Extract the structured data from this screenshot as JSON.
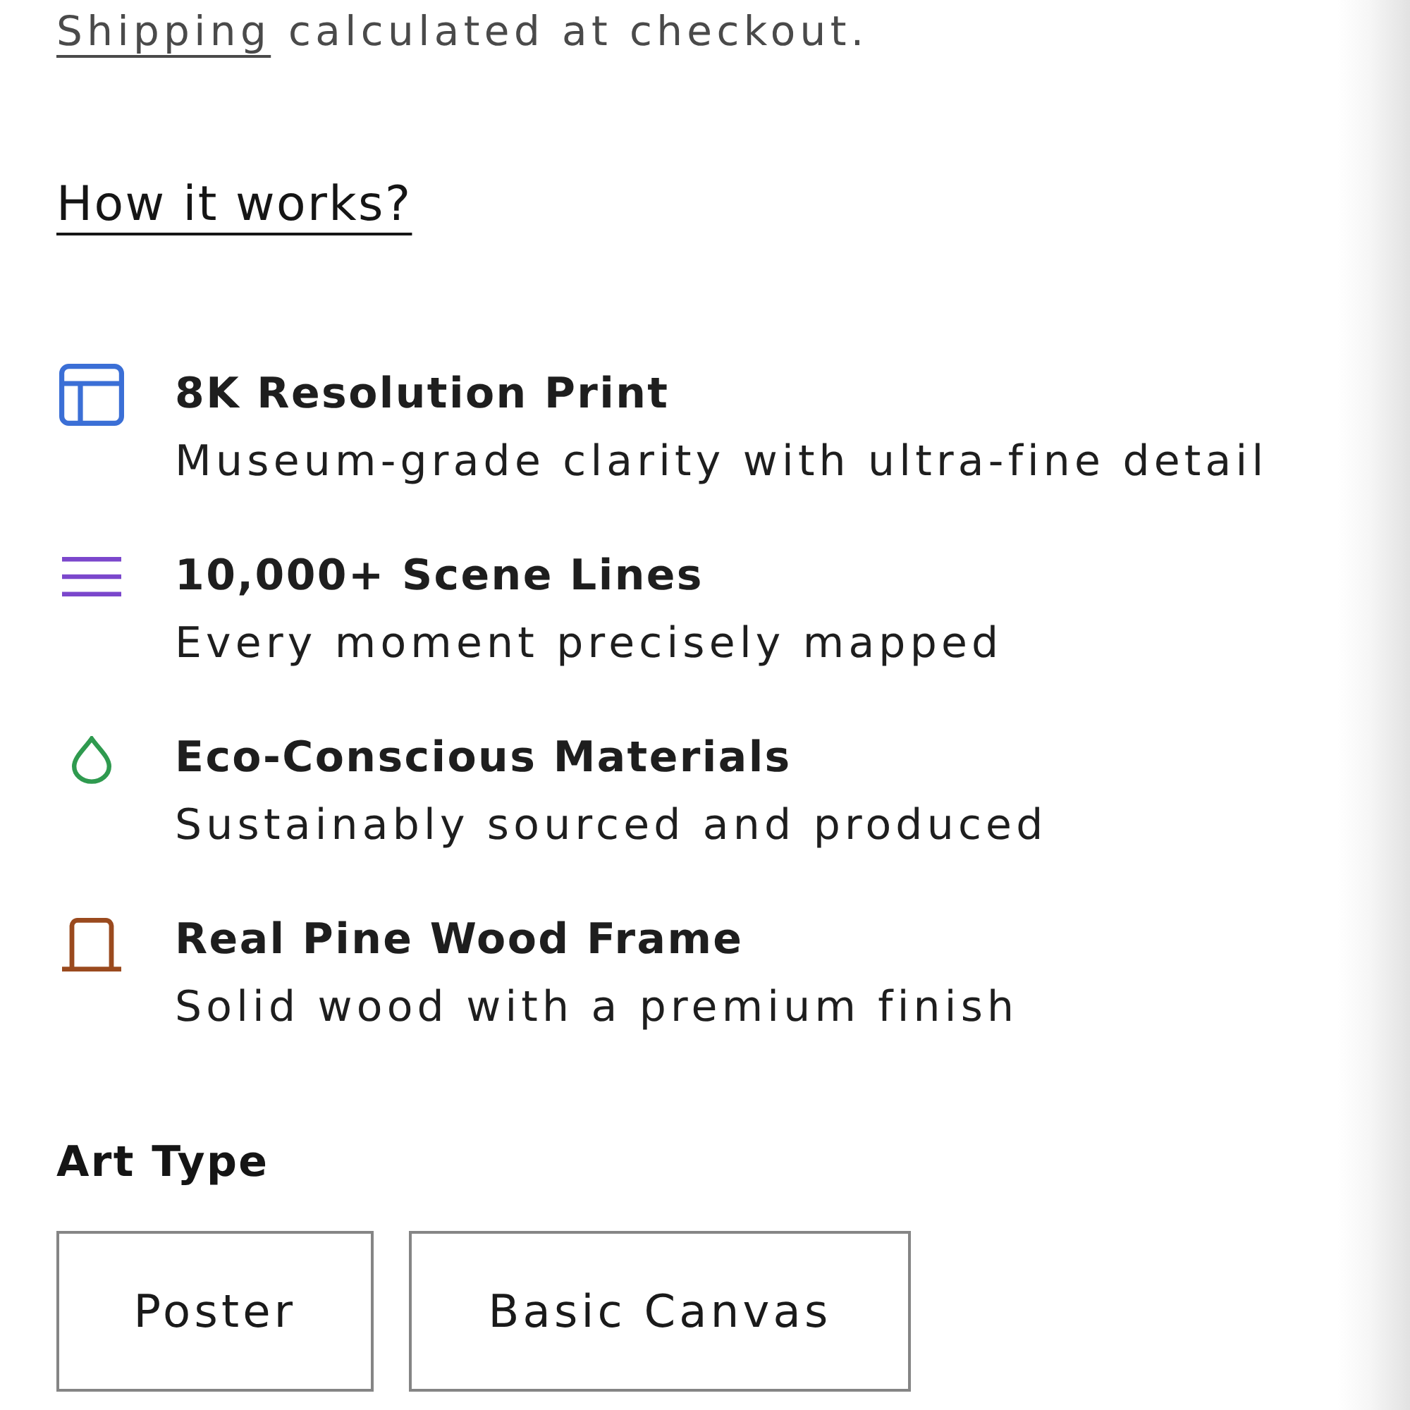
{
  "shipping_note": {
    "link": "Shipping",
    "text": "calculated at checkout."
  },
  "how_it_works_link": "How it works?",
  "features": [
    {
      "title": "8K Resolution Print",
      "description": "Museum-grade clarity with ultra-fine detail",
      "color": "#3b6fd6"
    },
    {
      "title": "10,000+ Scene Lines",
      "description": "Every moment precisely mapped",
      "color": "#7b47cc"
    },
    {
      "title": "Eco-Conscious Materials",
      "description": "Sustainably sourced and produced",
      "color": "#2f9a4f"
    },
    {
      "title": "Real Pine Wood Frame",
      "description": "Solid wood with a premium finish",
      "color": "#9a4a1e"
    }
  ],
  "art_type": {
    "label": "Art Type",
    "options": [
      {
        "label": "Poster",
        "selected": false
      },
      {
        "label": "Basic Canvas",
        "selected": false
      }
    ]
  }
}
